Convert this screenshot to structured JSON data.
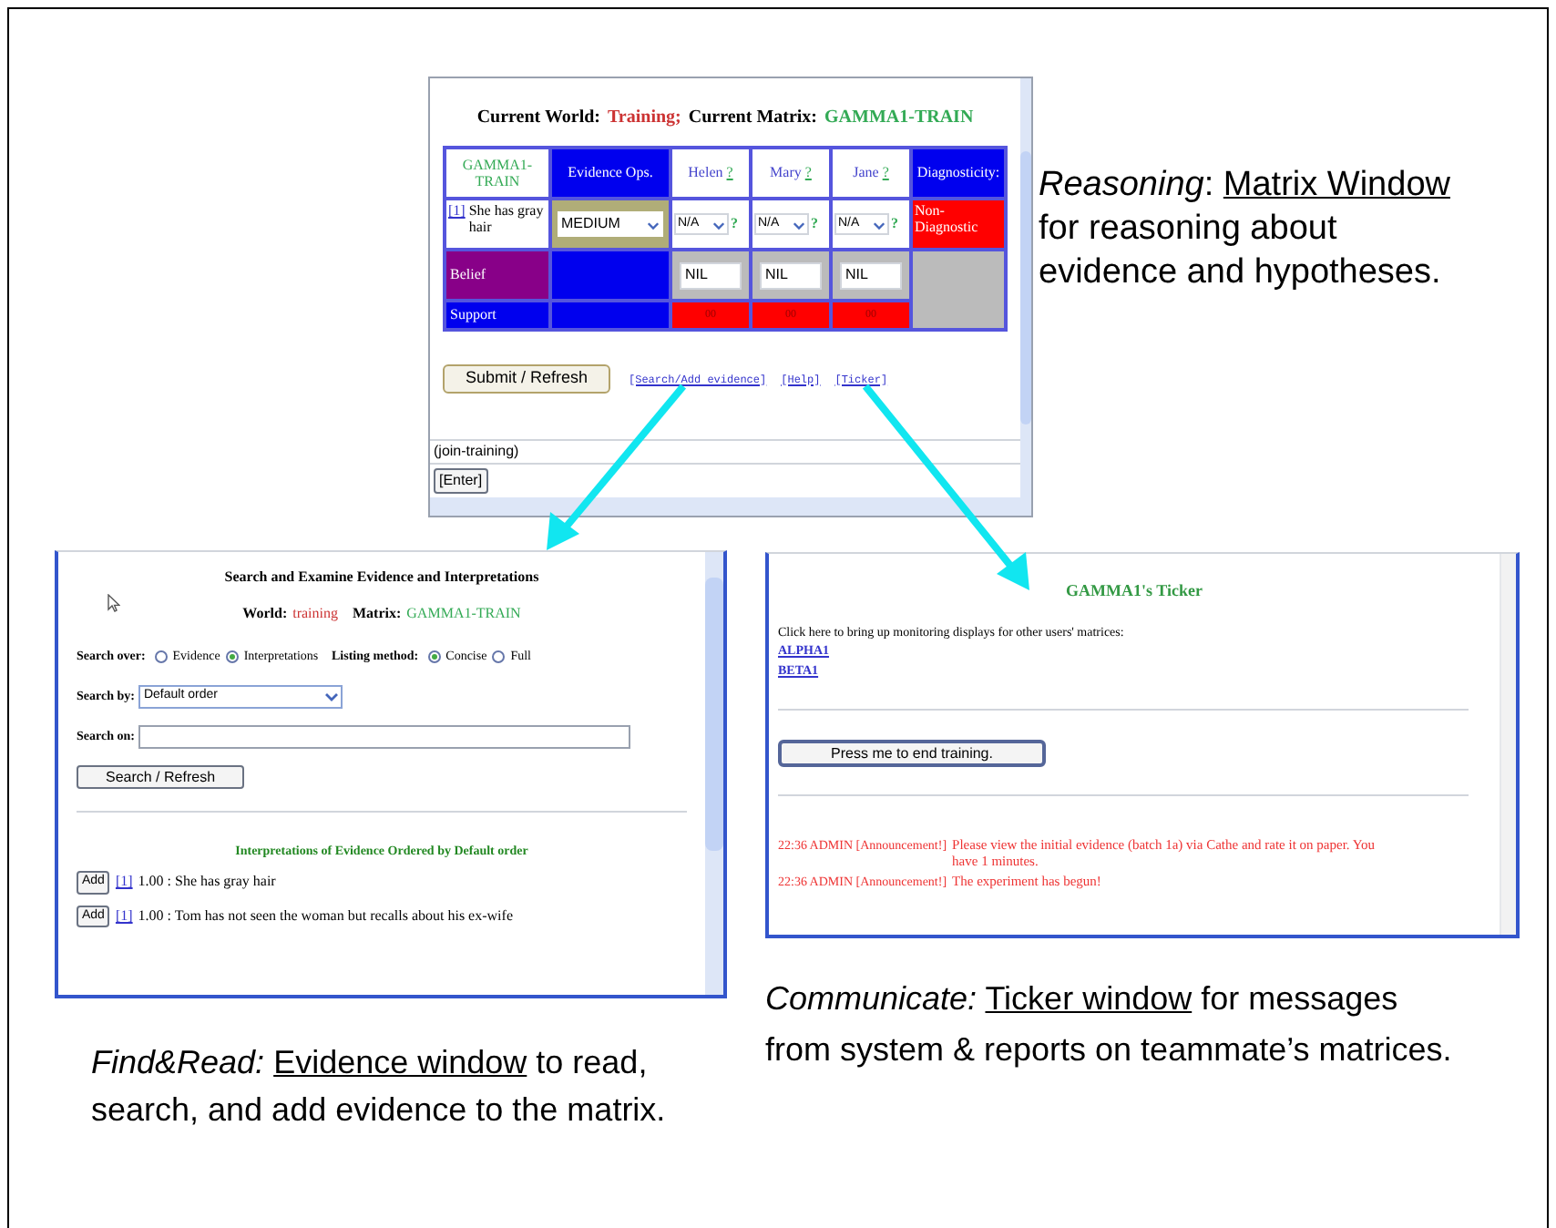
{
  "matrix_window": {
    "world_label": "Current World:",
    "world": "Training;",
    "matrix_label": "Current Matrix:",
    "matrix": "GAMMA1-TRAIN",
    "table": {
      "corner": "GAMMA1-TRAIN",
      "ops_header": "Evidence Ops.",
      "diag_header": "Diagnosticity:",
      "hypotheses": [
        {
          "name": "Helen",
          "mark": "?"
        },
        {
          "name": "Mary",
          "mark": "?"
        },
        {
          "name": "Jane",
          "mark": "?"
        }
      ],
      "evidence": {
        "ref": "[1]",
        "text": "She has gray hair",
        "ops": "MEDIUM",
        "ratings": [
          "N/A",
          "N/A",
          "N/A"
        ],
        "help": "?",
        "diagnosticity": "Non-Diagnostic"
      },
      "belief": {
        "label": "Belief",
        "values": [
          "NIL",
          "NIL",
          "NIL"
        ]
      },
      "support": {
        "label": "Support",
        "values": [
          "00",
          "00",
          "00"
        ]
      }
    },
    "submit_button": "Submit / Refresh",
    "links": [
      "[Search/Add evidence]",
      "[Help]",
      "[Ticker]"
    ],
    "command": "(join-training)",
    "enter_button": "[Enter]"
  },
  "evidence_window": {
    "title": "Search and Examine Evidence and Interpretations",
    "world_label": "World:",
    "world": "training",
    "matrix_label": "Matrix:",
    "matrix": "GAMMA1-TRAIN",
    "search_over": {
      "label": "Search over:",
      "options": [
        {
          "label": "Evidence",
          "selected": false
        },
        {
          "label": "Interpretations",
          "selected": true
        }
      ]
    },
    "listing_method": {
      "label": "Listing method:",
      "options": [
        {
          "label": "Concise",
          "selected": true
        },
        {
          "label": "Full",
          "selected": false
        }
      ]
    },
    "search_by": {
      "label": "Search by:",
      "value": "Default order"
    },
    "search_on": {
      "label": "Search on:"
    },
    "search_button": "Search / Refresh",
    "heading": "Interpretations of Evidence Ordered by Default order",
    "items": [
      {
        "button": "Add",
        "ref": "[1]",
        "text": "1.00 : She has gray hair"
      },
      {
        "button": "Add",
        "ref": "[1]",
        "text": "1.00 : Tom has not seen the woman but recalls about his ex-wife"
      }
    ]
  },
  "ticker_window": {
    "title": "GAMMA1's Ticker",
    "prompt": "Click here to bring up monitoring displays for other users' matrices:",
    "users": [
      "ALPHA1",
      "BETA1"
    ],
    "end_button": "Press me to end training.",
    "messages": [
      {
        "time": "22:36",
        "sender": "ADMIN",
        "tag": "[Announcement!]",
        "text": "Please view the initial evidence (batch 1a) via Cathe and rate it on paper. You have 1 minutes."
      },
      {
        "time": "22:36",
        "sender": "ADMIN",
        "tag": "[Announcement!]",
        "text": "The experiment has begun!"
      }
    ]
  },
  "captions": [
    {
      "lead": "Reasoning",
      "sep": ":",
      "link": "Matrix Window",
      "rest": "for reasoning about evidence and hypotheses."
    },
    {
      "lead": "Find&Read:",
      "link": "Evidence window",
      "rest": "to read, search, and add evidence to the matrix."
    },
    {
      "lead": "Communicate:",
      "link": "Ticker window",
      "rest": "for messages from system & reports on teammate’s matrices."
    }
  ]
}
